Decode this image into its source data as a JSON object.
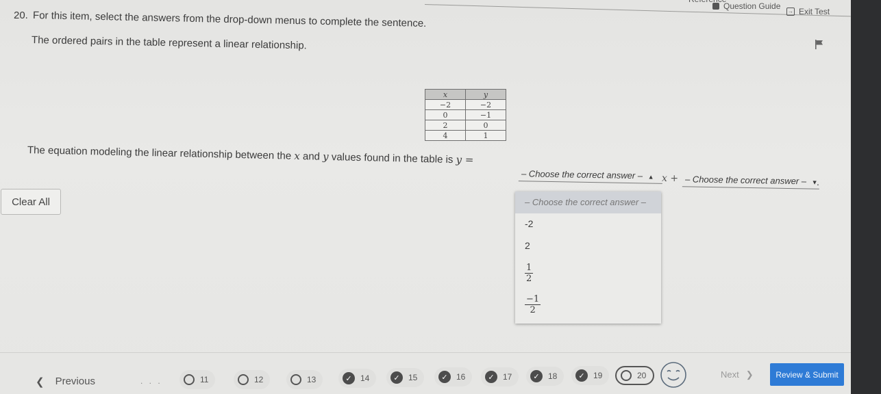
{
  "header": {
    "reference_label": "Reference",
    "question_guide_label": "Question Guide",
    "exit_label": "Exit Test"
  },
  "question": {
    "number": "20.",
    "prompt": "For this item, select the answers from the drop-down menus to complete the sentence.",
    "stem": "The ordered pairs in the table represent a linear relationship.",
    "table": {
      "headers": [
        "x",
        "y"
      ],
      "rows": [
        [
          "−2",
          "−2"
        ],
        [
          "0",
          "−1"
        ],
        [
          "2",
          "0"
        ],
        [
          "4",
          "1"
        ]
      ]
    },
    "sentence_text": "The equation modeling the linear relationship between the",
    "var_x": "x",
    "and_text": "and",
    "var_y": "y",
    "sentence_tail": "values found in the table is",
    "eq_lhs": "y =",
    "x_plus": "+",
    "period": "."
  },
  "dropdowns": [
    {
      "value": "– Choose the correct answer –",
      "state": "open",
      "caret": "▲"
    },
    {
      "value": "– Choose the correct answer –",
      "state": "closed",
      "caret": "▼"
    }
  ],
  "menu": {
    "placeholder": "– Choose the correct answer –",
    "options": [
      {
        "label": "-2"
      },
      {
        "label": "2"
      },
      {
        "label": "1/2",
        "numerator": "1",
        "denominator": "2"
      },
      {
        "label": "-1/2",
        "numerator": "−1",
        "denominator": "2"
      }
    ]
  },
  "clear_all_label": "Clear All",
  "footer": {
    "previous_label": "Previous",
    "previous_icon": "❮",
    "ellipsis": ". . .",
    "questions": [
      {
        "number": "11",
        "status": "unanswered"
      },
      {
        "number": "12",
        "status": "unanswered"
      },
      {
        "number": "13",
        "status": "unanswered"
      },
      {
        "number": "14",
        "status": "answered"
      },
      {
        "number": "15",
        "status": "answered"
      },
      {
        "number": "16",
        "status": "answered"
      },
      {
        "number": "17",
        "status": "answered"
      },
      {
        "number": "18",
        "status": "answered"
      },
      {
        "number": "19",
        "status": "answered"
      },
      {
        "number": "20",
        "status": "current"
      }
    ],
    "next_label": "Next",
    "next_icon": "❯",
    "review_submit_label": "Review & Submit",
    "review_color": "#2e7bd6"
  }
}
